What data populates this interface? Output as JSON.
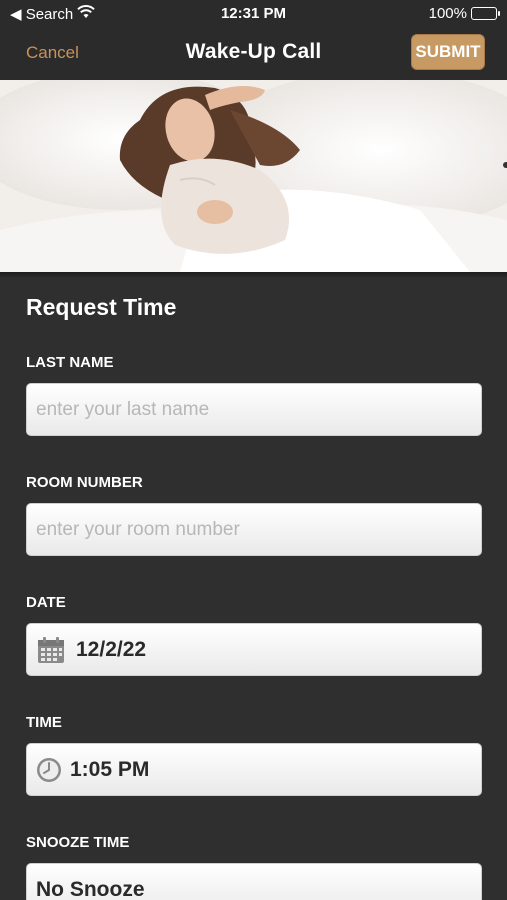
{
  "status_bar": {
    "back_label": "◀ Search",
    "time": "12:31 PM",
    "battery": "100%"
  },
  "nav": {
    "cancel_label": "Cancel",
    "title": "Wake-Up Call",
    "submit_label": "SUBMIT"
  },
  "form": {
    "section_title": "Request Time",
    "last_name": {
      "label": "LAST NAME",
      "placeholder": "enter your last name"
    },
    "room_number": {
      "label": "ROOM NUMBER",
      "placeholder": "enter your room number"
    },
    "date": {
      "label": "DATE",
      "value": "12/2/22",
      "icon": "calendar-icon"
    },
    "time": {
      "label": "TIME",
      "value": "1:05 PM",
      "icon": "clock-icon"
    },
    "snooze": {
      "label": "SNOOZE TIME",
      "value": "No Snooze"
    }
  },
  "colors": {
    "accent": "#c9925a",
    "submit_bg": "#c79a64",
    "background": "#2f2f2f"
  }
}
